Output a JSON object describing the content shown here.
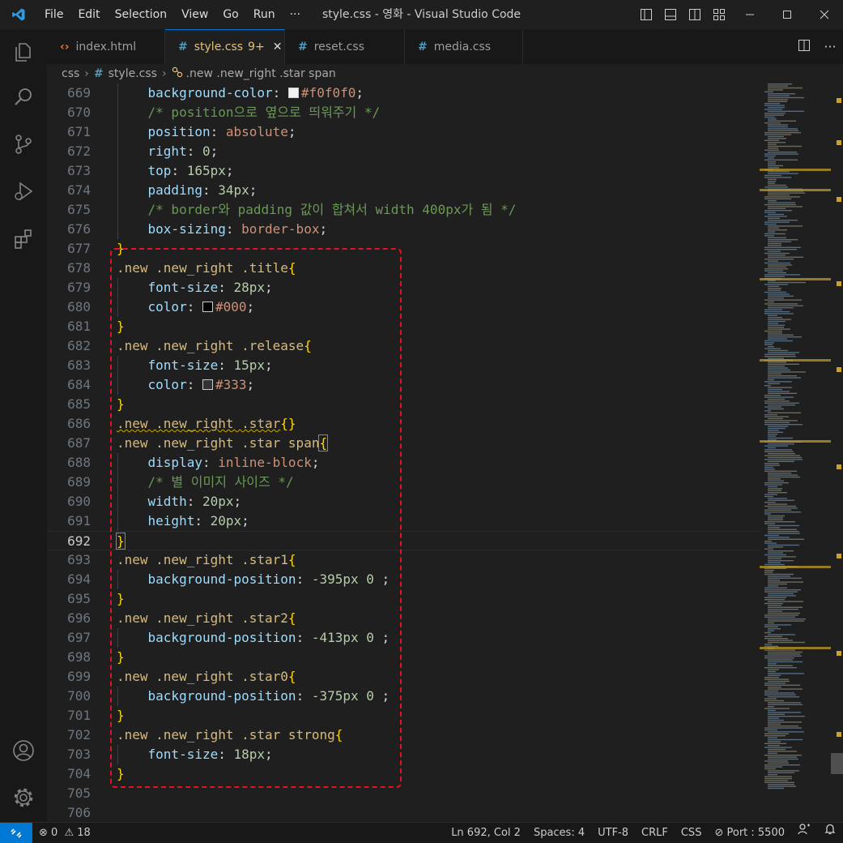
{
  "window": {
    "title": "style.css - 영화 - Visual Studio Code",
    "menu": [
      "File",
      "Edit",
      "Selection",
      "View",
      "Go",
      "Run",
      "···"
    ]
  },
  "tabs": [
    {
      "icon": "<>",
      "label": "index.html",
      "modified": "",
      "active": false
    },
    {
      "icon": "#",
      "label": "style.css",
      "modified": "9+",
      "active": true
    },
    {
      "icon": "#",
      "label": "reset.css",
      "modified": "",
      "active": false
    },
    {
      "icon": "#",
      "label": "media.css",
      "modified": "",
      "active": false
    }
  ],
  "breadcrumb": {
    "folder": "css",
    "file": "style.css",
    "symbol": ".new .new_right .star span"
  },
  "editor": {
    "current_line": "692",
    "lines": [
      {
        "n": "669",
        "indent": 1,
        "tokens": [
          [
            "prop",
            "background-color"
          ],
          [
            "punc",
            ": "
          ],
          [
            "swatch",
            "#f0f0f0"
          ],
          [
            "val",
            "#f0f0f0"
          ],
          [
            "punc",
            ";"
          ]
        ]
      },
      {
        "n": "670",
        "indent": 1,
        "tokens": [
          [
            "cmt",
            "/* position으로 옆으로 띄워주기 */"
          ]
        ]
      },
      {
        "n": "671",
        "indent": 1,
        "tokens": [
          [
            "prop",
            "position"
          ],
          [
            "punc",
            ": "
          ],
          [
            "val",
            "absolute"
          ],
          [
            "punc",
            ";"
          ]
        ]
      },
      {
        "n": "672",
        "indent": 1,
        "tokens": [
          [
            "prop",
            "right"
          ],
          [
            "punc",
            ": "
          ],
          [
            "num",
            "0"
          ],
          [
            "punc",
            ";"
          ]
        ]
      },
      {
        "n": "673",
        "indent": 1,
        "tokens": [
          [
            "prop",
            "top"
          ],
          [
            "punc",
            ": "
          ],
          [
            "num",
            "165px"
          ],
          [
            "punc",
            ";"
          ]
        ]
      },
      {
        "n": "674",
        "indent": 1,
        "tokens": [
          [
            "prop",
            "padding"
          ],
          [
            "punc",
            ": "
          ],
          [
            "num",
            "34px"
          ],
          [
            "punc",
            ";"
          ]
        ]
      },
      {
        "n": "675",
        "indent": 1,
        "tokens": [
          [
            "cmt",
            "/* border와 padding 값이 합쳐서 width 400px가 됨 */"
          ]
        ]
      },
      {
        "n": "676",
        "indent": 1,
        "tokens": [
          [
            "prop",
            "box-sizing"
          ],
          [
            "punc",
            ": "
          ],
          [
            "val",
            "border-box"
          ],
          [
            "punc",
            ";"
          ]
        ]
      },
      {
        "n": "677",
        "indent": 0,
        "tokens": [
          [
            "brace",
            "}"
          ]
        ]
      },
      {
        "n": "678",
        "indent": 0,
        "tokens": [
          [
            "sel",
            ".new .new_right .title"
          ],
          [
            "brace",
            "{"
          ]
        ]
      },
      {
        "n": "679",
        "indent": 1,
        "tokens": [
          [
            "prop",
            "font-size"
          ],
          [
            "punc",
            ": "
          ],
          [
            "num",
            "28px"
          ],
          [
            "punc",
            ";"
          ]
        ]
      },
      {
        "n": "680",
        "indent": 1,
        "tokens": [
          [
            "prop",
            "color"
          ],
          [
            "punc",
            ": "
          ],
          [
            "swatch",
            "#000000"
          ],
          [
            "val",
            "#000"
          ],
          [
            "punc",
            ";"
          ]
        ]
      },
      {
        "n": "681",
        "indent": 0,
        "tokens": [
          [
            "brace",
            "}"
          ]
        ]
      },
      {
        "n": "682",
        "indent": 0,
        "tokens": [
          [
            "sel",
            ".new .new_right .release"
          ],
          [
            "brace",
            "{"
          ]
        ]
      },
      {
        "n": "683",
        "indent": 1,
        "tokens": [
          [
            "prop",
            "font-size"
          ],
          [
            "punc",
            ": "
          ],
          [
            "num",
            "15px"
          ],
          [
            "punc",
            ";"
          ]
        ]
      },
      {
        "n": "684",
        "indent": 1,
        "tokens": [
          [
            "prop",
            "color"
          ],
          [
            "punc",
            ": "
          ],
          [
            "swatch",
            "#333333"
          ],
          [
            "val",
            "#333"
          ],
          [
            "punc",
            ";"
          ]
        ]
      },
      {
        "n": "685",
        "indent": 0,
        "tokens": [
          [
            "brace",
            "}"
          ]
        ]
      },
      {
        "n": "686",
        "indent": 0,
        "tokens": [
          [
            "selsq",
            ".new .new_right .star"
          ],
          [
            "brace",
            "{}"
          ]
        ]
      },
      {
        "n": "687",
        "indent": 0,
        "tokens": [
          [
            "sel",
            ".new .new_right .star span"
          ],
          [
            "bracem",
            "{"
          ]
        ]
      },
      {
        "n": "688",
        "indent": 1,
        "tokens": [
          [
            "prop",
            "display"
          ],
          [
            "punc",
            ": "
          ],
          [
            "val",
            "inline-block"
          ],
          [
            "punc",
            ";"
          ]
        ]
      },
      {
        "n": "689",
        "indent": 1,
        "tokens": [
          [
            "cmt",
            "/* 별 이미지 사이즈 */"
          ]
        ]
      },
      {
        "n": "690",
        "indent": 1,
        "tokens": [
          [
            "prop",
            "width"
          ],
          [
            "punc",
            ": "
          ],
          [
            "num",
            "20px"
          ],
          [
            "punc",
            ";"
          ]
        ]
      },
      {
        "n": "691",
        "indent": 1,
        "tokens": [
          [
            "prop",
            "height"
          ],
          [
            "punc",
            ": "
          ],
          [
            "num",
            "20px"
          ],
          [
            "punc",
            ";"
          ]
        ]
      },
      {
        "n": "692",
        "indent": 0,
        "tokens": [
          [
            "bracem",
            "}"
          ]
        ]
      },
      {
        "n": "693",
        "indent": 0,
        "tokens": [
          [
            "sel",
            ".new .new_right .star1"
          ],
          [
            "brace",
            "{"
          ]
        ]
      },
      {
        "n": "694",
        "indent": 1,
        "tokens": [
          [
            "prop",
            "background-position"
          ],
          [
            "punc",
            ": "
          ],
          [
            "num",
            "-395px"
          ],
          [
            "punc",
            " "
          ],
          [
            "num",
            "0"
          ],
          [
            "punc",
            " ;"
          ]
        ]
      },
      {
        "n": "695",
        "indent": 0,
        "tokens": [
          [
            "brace",
            "}"
          ]
        ]
      },
      {
        "n": "696",
        "indent": 0,
        "tokens": [
          [
            "sel",
            ".new .new_right .star2"
          ],
          [
            "brace",
            "{"
          ]
        ]
      },
      {
        "n": "697",
        "indent": 1,
        "tokens": [
          [
            "prop",
            "background-position"
          ],
          [
            "punc",
            ": "
          ],
          [
            "num",
            "-413px"
          ],
          [
            "punc",
            " "
          ],
          [
            "num",
            "0"
          ],
          [
            "punc",
            " ;"
          ]
        ]
      },
      {
        "n": "698",
        "indent": 0,
        "tokens": [
          [
            "brace",
            "}"
          ]
        ]
      },
      {
        "n": "699",
        "indent": 0,
        "tokens": [
          [
            "sel",
            ".new .new_right .star0"
          ],
          [
            "brace",
            "{"
          ]
        ]
      },
      {
        "n": "700",
        "indent": 1,
        "tokens": [
          [
            "prop",
            "background-position"
          ],
          [
            "punc",
            ": "
          ],
          [
            "num",
            "-375px"
          ],
          [
            "punc",
            " "
          ],
          [
            "num",
            "0"
          ],
          [
            "punc",
            " ;"
          ]
        ]
      },
      {
        "n": "701",
        "indent": 0,
        "tokens": [
          [
            "brace",
            "}"
          ]
        ]
      },
      {
        "n": "702",
        "indent": 0,
        "tokens": [
          [
            "sel",
            ".new .new_right .star strong"
          ],
          [
            "brace",
            "{"
          ]
        ]
      },
      {
        "n": "703",
        "indent": 1,
        "tokens": [
          [
            "prop",
            "font-size"
          ],
          [
            "punc",
            ": "
          ],
          [
            "num",
            "18px"
          ],
          [
            "punc",
            ";"
          ]
        ]
      },
      {
        "n": "704",
        "indent": 0,
        "tokens": [
          [
            "brace",
            "}"
          ]
        ]
      },
      {
        "n": "705",
        "indent": 0,
        "tokens": []
      },
      {
        "n": "706",
        "indent": 0,
        "tokens": []
      }
    ]
  },
  "statusbar": {
    "errors": "0",
    "warnings": "18",
    "position": "Ln 692, Col 2",
    "spaces": "Spaces: 4",
    "encoding": "UTF-8",
    "eol": "CRLF",
    "language": "CSS",
    "port": "Port : 5500"
  },
  "colors": {
    "accent": "#0078d4",
    "highlight_box": "#e81123",
    "modified_tab": "#e5c07b"
  }
}
